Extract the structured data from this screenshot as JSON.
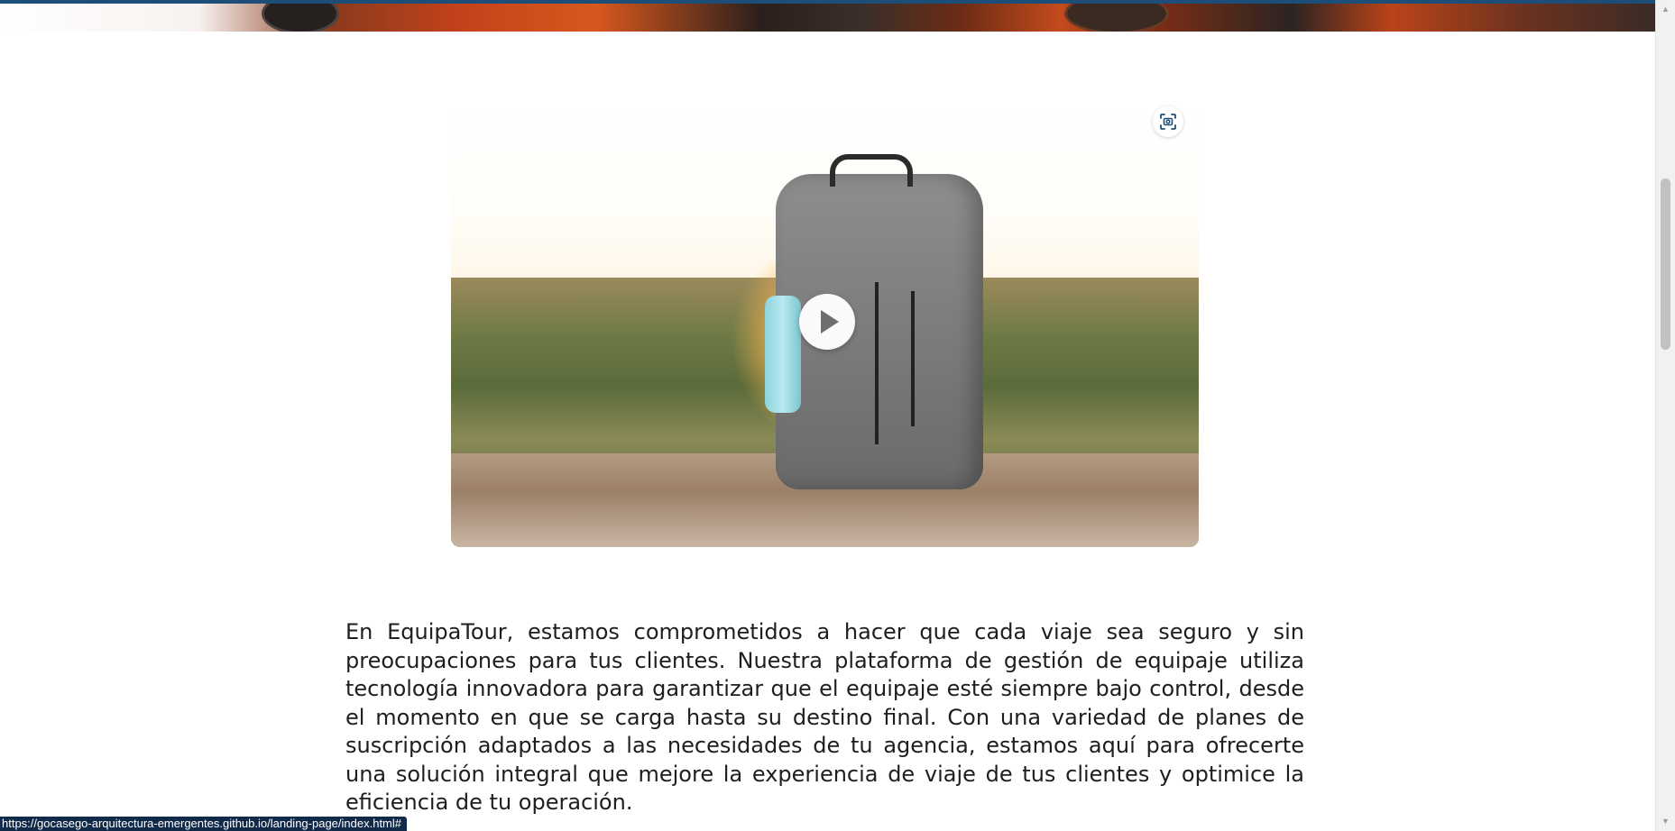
{
  "video": {
    "play_icon": "play-icon",
    "capture_icon": "focus-scan-icon"
  },
  "content": {
    "description": "En EquipaTour, estamos comprometidos a hacer que cada viaje sea seguro y sin preocupaciones para tus clientes. Nuestra plataforma de gestión de equipaje utiliza tecnología innovadora para garantizar que el equipaje esté siempre bajo control, desde el momento en que se carga hasta su destino final. Con una variedad de planes de suscripción adaptados a las necesidades de tu agencia, estamos aquí para ofrecerte una solución integral que mejore la experiencia de viaje de tus clientes y optimice la eficiencia de tu operación."
  },
  "status_bar": {
    "url": "https://gocasego-arquitectura-emergentes.github.io/landing-page/index.html#"
  },
  "colors": {
    "accent": "#1d4e79",
    "status_bar_bg": "#122a4a",
    "text": "#1e1e1e"
  }
}
